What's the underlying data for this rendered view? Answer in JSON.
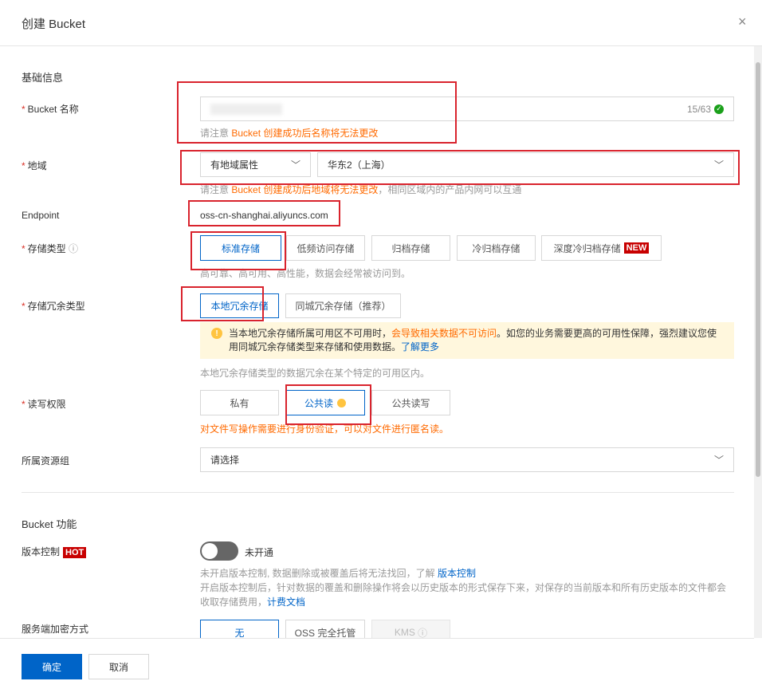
{
  "dialog": {
    "title": "创建 Bucket",
    "close": "×"
  },
  "basic": {
    "section": "基础信息",
    "name": {
      "label": "Bucket 名称",
      "counter": "15/63",
      "hint_prefix": "请注意 ",
      "hint_orange": "Bucket 创建成功后名称将无法更改"
    },
    "region": {
      "label": "地域",
      "type_value": "有地域属性",
      "region_value": "华东2（上海）",
      "hint_prefix": "请注意 ",
      "hint_orange": "Bucket 创建成功后地域将无法更改",
      "hint_suffix": "，相同区域内的产品内网可以互通"
    },
    "endpoint": {
      "label": "Endpoint",
      "value": "oss-cn-shanghai.aliyuncs.com"
    },
    "storage": {
      "label": "存储类型",
      "options": [
        "标准存储",
        "低频访问存储",
        "归档存储",
        "冷归档存储",
        "深度冷归档存储"
      ],
      "new_badge": "NEW",
      "hint": "高可靠、高可用、高性能，数据会经常被访问到。"
    },
    "redundancy": {
      "label": "存储冗余类型",
      "options": [
        "本地冗余存储",
        "同城冗余存储（推荐）"
      ],
      "alert_a": "当本地冗余存储所属可用区不可用时，",
      "alert_orange": "会导致相关数据不可访问",
      "alert_b": "。如您的业务需要更高的可用性保障，强烈建议您使用同城冗余存储类型来存储和使用数据。",
      "alert_link": "了解更多",
      "hint": "本地冗余存储类型的数据冗余在某个特定的可用区内。"
    },
    "acl": {
      "label": "读写权限",
      "options": [
        "私有",
        "公共读",
        "公共读写"
      ],
      "warning": "对文件写操作需要进行身份验证，可以对文件进行匿名读。"
    },
    "resource_group": {
      "label": "所属资源组",
      "placeholder": "请选择"
    }
  },
  "features": {
    "section": "Bucket 功能",
    "versioning": {
      "label": "版本控制",
      "badge": "HOT",
      "status": "未开通",
      "desc1": "未开启版本控制, 数据删除或被覆盖后将无法找回，了解 ",
      "desc1_link": "版本控制",
      "desc2": "开启版本控制后，针对数据的覆盖和删除操作将会以历史版本的形式保存下来，对保存的当前版本和所有历史版本的文件都会收取存储费用，",
      "desc2_link": "计费文档"
    },
    "encryption": {
      "label": "服务端加密方式",
      "options": [
        "无",
        "OSS 完全托管",
        "KMS"
      ]
    }
  },
  "footer": {
    "ok": "确定",
    "cancel": "取消"
  },
  "colors": {
    "primary": "#0064c8",
    "orange": "#ff6a00",
    "annotation": "#d9232d"
  }
}
